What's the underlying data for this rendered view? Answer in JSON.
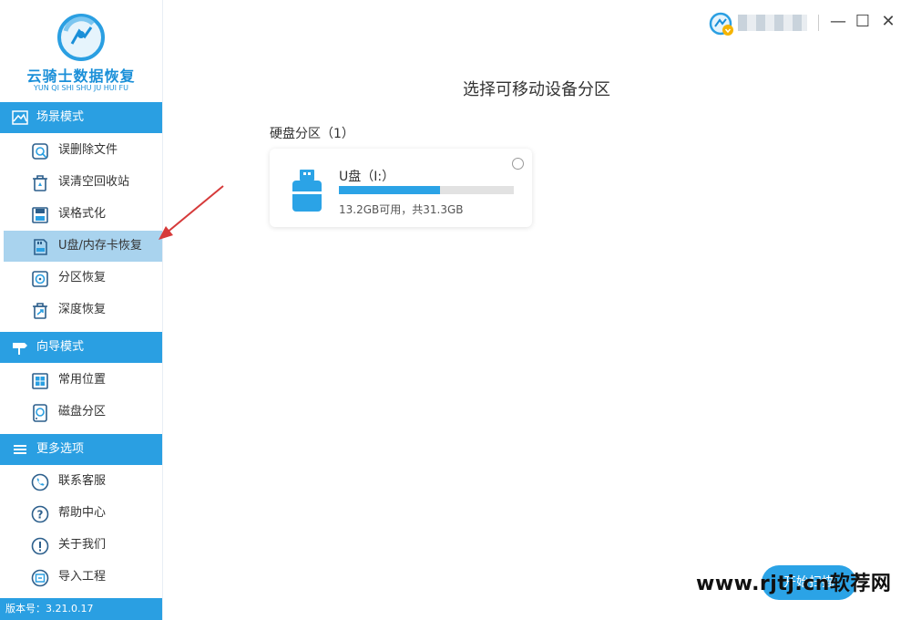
{
  "app": {
    "name": "云骑士数据恢复",
    "name_pinyin": "YUN QI SHI SHU JU HUI FU",
    "version": "版本号：3.21.0.17"
  },
  "sidebar": {
    "sections": [
      {
        "label": "场景模式",
        "icon": "mountain-icon",
        "items": [
          {
            "label": "误删除文件",
            "icon": "delete-file-icon"
          },
          {
            "label": "误清空回收站",
            "icon": "recycle-bin-icon"
          },
          {
            "label": "误格式化",
            "icon": "floppy-disk-icon"
          },
          {
            "label": "U盘/内存卡恢复",
            "icon": "sd-card-icon",
            "active": true
          },
          {
            "label": "分区恢复",
            "icon": "partition-icon"
          },
          {
            "label": "深度恢复",
            "icon": "deep-recovery-icon"
          }
        ]
      },
      {
        "label": "向导模式",
        "icon": "signpost-icon",
        "items": [
          {
            "label": "常用位置",
            "icon": "windows-icon"
          },
          {
            "label": "磁盘分区",
            "icon": "disk-icon"
          }
        ]
      },
      {
        "label": "更多选项",
        "icon": "menu-icon",
        "items": [
          {
            "label": "联系客服",
            "icon": "phone-icon"
          },
          {
            "label": "帮助中心",
            "icon": "help-icon"
          },
          {
            "label": "关于我们",
            "icon": "info-icon"
          },
          {
            "label": "导入工程",
            "icon": "import-icon"
          }
        ]
      }
    ]
  },
  "window": {
    "minimize": "—",
    "maximize": "☐",
    "close": "✕"
  },
  "main": {
    "title": "选择可移动设备分区",
    "group_label": "硬盘分区（1）",
    "devices": [
      {
        "name": "U盘（I:）",
        "info": "13.2GB可用，共31.3GB",
        "used_fraction": 0.58,
        "icon": "usb-drive-icon"
      }
    ],
    "next_button": "开始扫描"
  },
  "watermark": "www.rjtj.cn软荐网",
  "colors": {
    "accent": "#2a9fe2",
    "active_bg": "#a9d3ee",
    "arrow": "#d63a3a"
  }
}
